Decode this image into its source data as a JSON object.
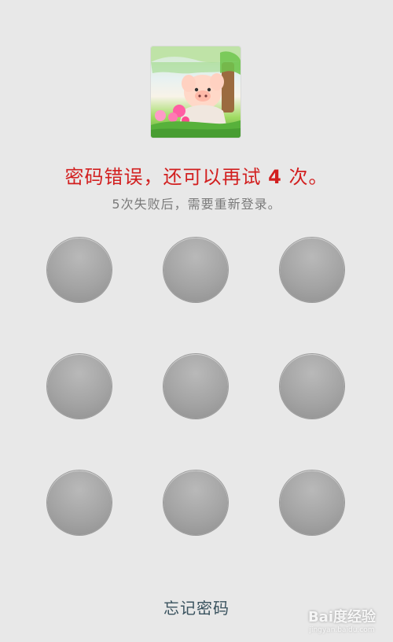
{
  "avatar": {
    "icon": "pig-cartoon-avatar"
  },
  "message": {
    "error_prefix": "密码错误，还可以再试",
    "remaining_attempts": "4",
    "error_suffix": "次。",
    "hint": "5次失败后，需要重新登录。"
  },
  "pattern": {
    "dot_count": 9
  },
  "footer": {
    "forgot_label": "忘记密码"
  },
  "watermark": {
    "text": "Bai度经验",
    "subtext": "jingyan.baidu.com"
  },
  "colors": {
    "background": "#e8e8e8",
    "error": "#d21f1f",
    "hint": "#7a7a7a",
    "dot": "#a4a4a4",
    "link": "#39525e"
  }
}
